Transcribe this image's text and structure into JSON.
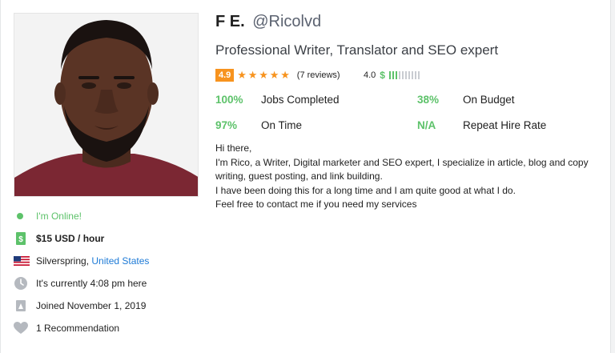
{
  "profile": {
    "name": "F E.",
    "handle": "@Ricolvd",
    "tagline": "Professional Writer, Translator and SEO expert",
    "rating": "4.9",
    "rating_stars": 5,
    "reviews": "(7 reviews)",
    "earnings_score": "4.0",
    "earnings_symbol": "$",
    "earnings_level": 0.3
  },
  "stats": [
    {
      "value": "100%",
      "label": "Jobs Completed"
    },
    {
      "value": "38%",
      "label": "On Budget"
    },
    {
      "value": "97%",
      "label": "On Time"
    },
    {
      "value": "N/A",
      "label": "Repeat Hire Rate"
    }
  ],
  "about": [
    "Hi there,",
    "I'm Rico, a Writer, Digital marketer and SEO expert, I specialize in article, blog and copy writing, guest posting, and link building.",
    "I have been doing this for a long time and I am quite good at what I do.",
    "Feel free to contact me if you need my services"
  ],
  "info": {
    "online": "I'm Online!",
    "rate": "$15 USD / hour",
    "city": "Silverspring,",
    "country": "United States",
    "local_time": "It's currently 4:08 pm here",
    "joined": "Joined November 1, 2019",
    "recommendations": "1 Recommendation"
  },
  "colors": {
    "accent_green": "#5dc26a",
    "rating_orange": "#f7931e",
    "link_blue": "#1d7ad6"
  },
  "icons": [
    "online-dot-icon",
    "money-icon",
    "us-flag-icon",
    "clock-icon",
    "calendar-icon",
    "heart-icon"
  ]
}
